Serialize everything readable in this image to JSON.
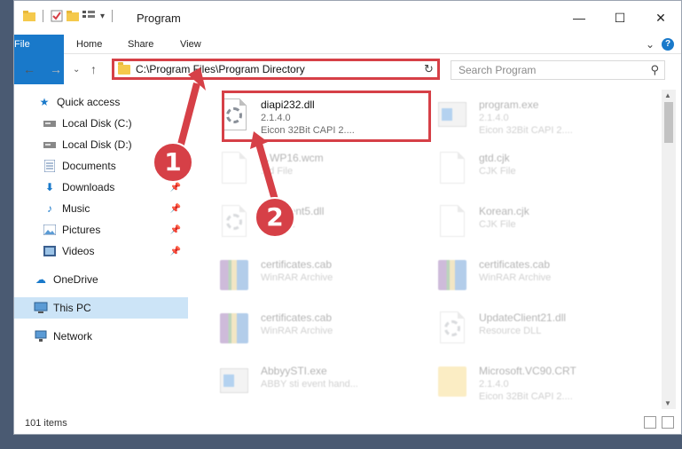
{
  "window": {
    "title": "Program",
    "controls": {
      "minimize": "—",
      "maximize": "☐",
      "close": "✕"
    }
  },
  "ribbon": {
    "tabs": [
      {
        "label": "File"
      },
      {
        "label": "Home"
      },
      {
        "label": "Share"
      },
      {
        "label": "View"
      }
    ],
    "expand": "⌄",
    "help": "?"
  },
  "nav": {
    "back": "←",
    "forward": "→",
    "recent": "⌄",
    "up": "↑",
    "address": "C:\\Program Files\\Program Directory",
    "address_dropdown": "⌄",
    "refresh": "↻",
    "search_placeholder": "Search Program",
    "search_icon": "⚲"
  },
  "sidebar": {
    "items": [
      {
        "label": "Quick access"
      },
      {
        "label": "Local Disk (C:)"
      },
      {
        "label": "Local Disk (D:)"
      },
      {
        "label": "Documents"
      },
      {
        "label": "Downloads"
      },
      {
        "label": "Music"
      },
      {
        "label": "Pictures"
      },
      {
        "label": "Videos"
      },
      {
        "label": "OneDrive"
      },
      {
        "label": "This PC"
      },
      {
        "label": "Network"
      }
    ]
  },
  "files": [
    {
      "name": "diapi232.dll",
      "line2": "2.1.4.0",
      "line3": "Eicon 32Bit CAPI 2...."
    },
    {
      "name": "program.exe",
      "line2": "2.1.4.0",
      "line3": "Eicon 32Bit CAPI 2...."
    },
    {
      "name": "...WP16.wcm",
      "line2": "...d File",
      "line3": ""
    },
    {
      "name": "gtd.cjk",
      "line2": "CJK File",
      "line3": ""
    },
    {
      "name": "U...Client5.dll",
      "line2": "...e DLL",
      "line3": ""
    },
    {
      "name": "Korean.cjk",
      "line2": "CJK File",
      "line3": ""
    },
    {
      "name": "certificates.cab",
      "line2": "WinRAR Archive",
      "line3": ""
    },
    {
      "name": "certificates.cab",
      "line2": "WinRAR Archive",
      "line3": ""
    },
    {
      "name": "certificates.cab",
      "line2": "WinRAR Archive",
      "line3": ""
    },
    {
      "name": "UpdateClient21.dll",
      "line2": "Resource DLL",
      "line3": ""
    },
    {
      "name": "AbbyySTI.exe",
      "line2": "ABBY sti event hand...",
      "line3": ""
    },
    {
      "name": "Microsoft.VC90.CRT",
      "line2": "2.1.4.0",
      "line3": "Eicon 32Bit CAPI 2...."
    }
  ],
  "annotations": {
    "marker1": "1",
    "marker2": "2"
  },
  "status": {
    "items_count": "101 items"
  },
  "colors": {
    "accent": "#1979ca",
    "highlight": "#d64047",
    "selected": "#cce4f7"
  }
}
